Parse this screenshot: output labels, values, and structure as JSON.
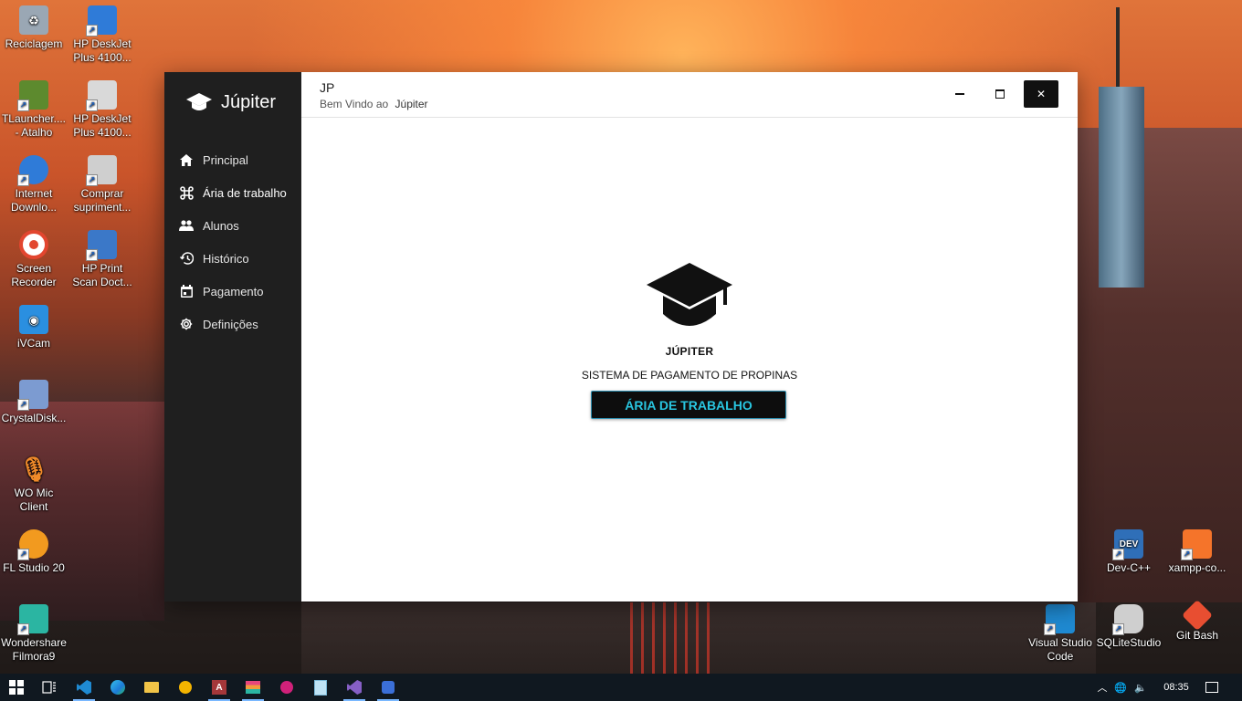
{
  "desktop": {
    "icons_left": [
      {
        "label": "Reciclagem",
        "icon": "recycle-bin-icon",
        "color": "#9aa7b4"
      },
      {
        "label": "TLauncher.... - Atalho",
        "icon": "minecraft-icon",
        "color": "#5d8a2e"
      },
      {
        "label": "Internet Downlo...",
        "icon": "idm-icon",
        "color": "#2f7bd8"
      },
      {
        "label": "Screen Recorder",
        "icon": "screen-recorder-icon",
        "color": "#e2462f"
      },
      {
        "label": "iVCam",
        "icon": "ivcam-icon",
        "color": "#2a8fe0"
      },
      {
        "label": "CrystalDisk...",
        "icon": "crystaldisk-icon",
        "color": "#7c9bd1"
      },
      {
        "label": "WO Mic Client",
        "icon": "microphone-icon",
        "color": "#f08a2a"
      },
      {
        "label": "FL Studio 20",
        "icon": "fl-studio-icon",
        "color": "#f29a1f"
      },
      {
        "label": "Wondershare Filmora9",
        "icon": "filmora-icon",
        "color": "#2bb5a2"
      }
    ],
    "icons_col2": [
      {
        "label": "HP DeskJet Plus 4100...",
        "icon": "hp-scanner-icon",
        "color": "#2f7bd8"
      },
      {
        "label": "HP DeskJet Plus 4100...",
        "icon": "hp-printer-icon",
        "color": "#d9d9d9"
      },
      {
        "label": "Comprar supriment...",
        "icon": "hp-supplies-icon",
        "color": "#cfcfcf"
      },
      {
        "label": "HP Print Scan Doct...",
        "icon": "hp-print-scan-doctor-icon",
        "color": "#3b78c8"
      }
    ],
    "icons_right": [
      {
        "label": "Dev-C++",
        "icon": "devcpp-icon",
        "color": "#2f6fb8"
      },
      {
        "label": "xampp-co...",
        "icon": "xampp-icon",
        "color": "#f5742a"
      },
      {
        "label": "Visual Studio Code",
        "icon": "vscode-icon",
        "color": "#1f8ad2"
      },
      {
        "label": "SQLiteStudio",
        "icon": "sqlitestudio-icon",
        "color": "#cfcfcf"
      },
      {
        "label": "Git Bash",
        "icon": "git-bash-icon",
        "color": "#e84e31"
      }
    ]
  },
  "app": {
    "brand": {
      "title": "Júpiter",
      "icon": "graduation-cap-icon"
    },
    "nav": [
      {
        "label": "Principal",
        "icon": "home-icon"
      },
      {
        "label": "Ária de trabalho",
        "icon": "command-icon",
        "active": true
      },
      {
        "label": "Alunos",
        "icon": "people-icon"
      },
      {
        "label": "Histórico",
        "icon": "history-icon"
      },
      {
        "label": "Pagamento",
        "icon": "calendar-icon"
      },
      {
        "label": "Definições",
        "icon": "gear-icon"
      }
    ],
    "header": {
      "title": "JP",
      "subtitle_prefix": "Bem Vindo ao",
      "subtitle_name": "Júpiter"
    },
    "window_controls": {
      "minimize": "minimize-icon",
      "maximize": "maximize-icon",
      "close": "close-icon",
      "close_glyph": "✕"
    },
    "hero": {
      "name": "JÚPITER",
      "subtitle": "SISTEMA DE PAGAMENTO DE PROPINAS",
      "button_label": "ÁRIA DE TRABALHO",
      "button_color": "#29c6e0"
    }
  },
  "taskbar": {
    "items": [
      {
        "name": "start-button",
        "icon": "windows-icon"
      },
      {
        "name": "task-view-button",
        "icon": "task-view-icon"
      },
      {
        "name": "taskbar-vscode",
        "icon": "vscode-icon",
        "running": true
      },
      {
        "name": "taskbar-edge",
        "icon": "edge-icon"
      },
      {
        "name": "taskbar-explorer",
        "icon": "folder-icon"
      },
      {
        "name": "taskbar-app-yellow",
        "icon": "triangle-app-icon"
      },
      {
        "name": "taskbar-access",
        "icon": "access-icon",
        "running": true
      },
      {
        "name": "taskbar-stack-app",
        "icon": "stack-icon",
        "running": true
      },
      {
        "name": "taskbar-pink-app",
        "icon": "gem-icon"
      },
      {
        "name": "taskbar-notepad",
        "icon": "notepad-icon"
      },
      {
        "name": "taskbar-visual-studio",
        "icon": "visual-studio-icon",
        "running": true
      },
      {
        "name": "taskbar-jupiter",
        "icon": "app-icon",
        "running": true
      }
    ],
    "clock": "08:35",
    "tray_icons": [
      "chevron-up-icon",
      "network-icon",
      "volume-icon",
      "notification-icon"
    ]
  }
}
